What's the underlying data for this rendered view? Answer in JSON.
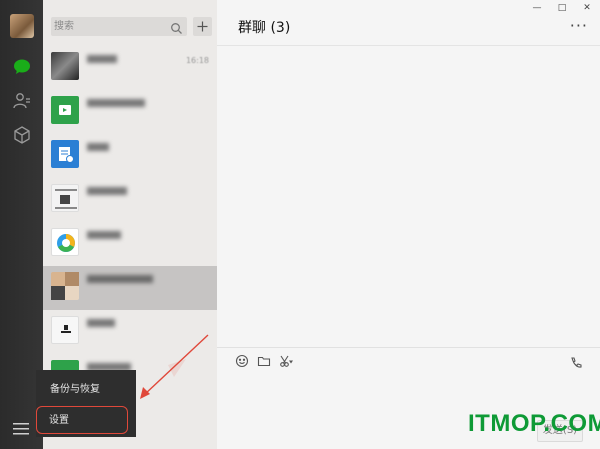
{
  "search": {
    "placeholder": "搜索"
  },
  "list": {
    "items": [
      {
        "time": "16:18"
      },
      {},
      {},
      {},
      {},
      {},
      {},
      {}
    ]
  },
  "popup": {
    "backup_label": "备份与恢复",
    "settings_label": "设置"
  },
  "chat": {
    "title": "群聊 (3)",
    "send_label": "发送(S)"
  },
  "watermark": "ITMOP.COM",
  "colors": {
    "accent": "#1aad19",
    "annotation": "#e0483a",
    "watermark": "#0e9a36"
  },
  "icons": {
    "rail": [
      "chat-icon",
      "contacts-icon",
      "favorites-icon"
    ],
    "menu": "menu-icon",
    "toolbar": [
      "emoji-icon",
      "folder-icon",
      "scissors-icon"
    ],
    "call": "video-call-icon"
  }
}
